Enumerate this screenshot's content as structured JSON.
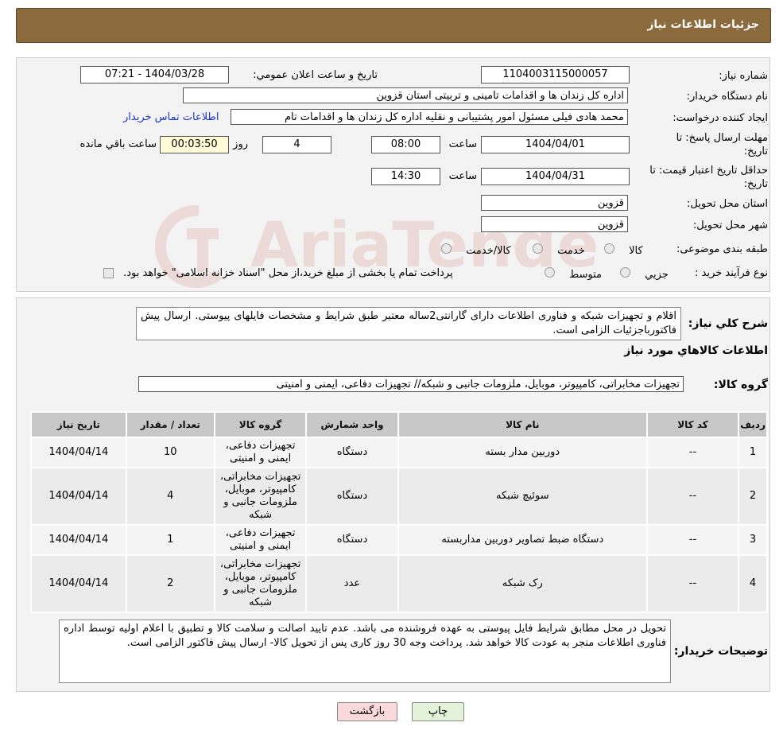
{
  "page_title": "جزئیات اطلاعات نیاز",
  "form": {
    "need_number_label": "شماره نیاز:",
    "need_number": "1104003115000057",
    "announce_label": "تاریخ و ساعت اعلان عمومي:",
    "announce_value": "1404/03/28 - 07:21",
    "buyer_org_label": "نام دستگاه خریدار:",
    "buyer_org": "اداره کل زندان ها و اقدامات تامینی و تربیتی استان قزوین",
    "requester_label": "ایجاد کننده درخواست:",
    "requester": "محمد هادی فیلی مسئول امور پشتیبانی و نقلیه اداره کل زندان ها و اقدامات تام",
    "contact_link": "اطلاعات تماس خریدار",
    "deadline_label_1": "مهلت ارسال پاسخ: تا",
    "deadline_label_2": "تاریخ:",
    "deadline_date": "1404/04/01",
    "time_label": "ساعت",
    "deadline_time": "08:00",
    "days_value": "4",
    "days_label": "روز و",
    "remaining_time": "00:03:50",
    "remaining_label": "ساعت باقي مانده",
    "validity_label_1": "حداقل تاریخ اعتبار قیمت: تا",
    "validity_label_2": "تاریخ:",
    "validity_date": "1404/04/31",
    "validity_time": "14:30",
    "province_label": "استان محل تحویل:",
    "province": "قزوین",
    "city_label": "شهر محل تحویل:",
    "city": "قزوین",
    "category_label": "طبقه بندی موضوعی:",
    "category_options": [
      "کالا",
      "خدمت",
      "کالا/خدمت"
    ],
    "process_label": "نوع فرآیند خرید :",
    "process_options": [
      "جزيي",
      "متوسط"
    ],
    "process_note": "پرداخت تمام یا بخشی از مبلغ خرید،از محل \"اسناد خزانه اسلامی\" خواهد بود."
  },
  "summary": {
    "label": "شرح کلي نياز:",
    "text": "اقلام و تجهیزات شبکه و فناوری اطلاعات دارای گارانتی2ساله معتبر طبق شرایط و مشخصات فایلهای پیوستی. ارسال پیش فاکتورباجزئیات الزامی است."
  },
  "goods_info_title": "اطلاعات کالاهاي مورد نياز",
  "goods_group": {
    "label": "گروه کالا:",
    "value": "تجهیزات مخابراتی، کامپیوتر، موبایل، ملزومات جانبی و شبکه// تجهیزات دفاعی، ایمنی و امنیتی"
  },
  "table": {
    "headers": [
      "رديف",
      "کد کالا",
      "نام کالا",
      "واحد شمارش",
      "گروه کالا",
      "تعداد / مقدار",
      "تاریخ نیاز"
    ],
    "rows": [
      {
        "row": "1",
        "code": "--",
        "name": "دوربین مدار بسته",
        "unit": "دستگاه",
        "group": "تجهیزات دفاعی، ایمنی و امنیتی",
        "qty": "10",
        "date": "1404/04/14"
      },
      {
        "row": "2",
        "code": "--",
        "name": "سوئیچ شبکه",
        "unit": "دستگاه",
        "group": "تجهیزات مخابراتی، کامپیوتر، موبایل، ملزومات جانبی و شبکه",
        "qty": "4",
        "date": "1404/04/14"
      },
      {
        "row": "3",
        "code": "--",
        "name": "دستگاه ضبط تصاویر دوربین مداربسته",
        "unit": "دستگاه",
        "group": "تجهیزات دفاعی، ایمنی و امنیتی",
        "qty": "1",
        "date": "1404/04/14"
      },
      {
        "row": "4",
        "code": "--",
        "name": "رک شبکه",
        "unit": "عدد",
        "group": "تجهیزات مخابراتی، کامپیوتر، موبایل، ملزومات جانبی و شبکه",
        "qty": "2",
        "date": "1404/04/14"
      }
    ]
  },
  "buyer_notes": {
    "label": "توضیحات خریدار:",
    "text": "تحویل در محل مطابق شرایط فایل پیوستی به عهده فروشنده می باشد. عدم تایید اصالت و سلامت کالا و تطبیق با اعلام اولیه توسط اداره فناوری اطلاعات منجر به عودت کالا خواهد شد. پرداخت وجه 30 روز کاری پس از تحویل کالا- ارسال پیش فاکتور الزامی است."
  },
  "buttons": {
    "print": "چاپ",
    "back": "بازگشت"
  },
  "watermark_text": "AriaTender.neT",
  "colors": {
    "header_bg": "#8b6a3e",
    "link": "#1a33cc",
    "timer_bg": "#fffbd6",
    "back_button_bg": "#f9d9d9",
    "print_button_bg": "#e3f3da"
  }
}
